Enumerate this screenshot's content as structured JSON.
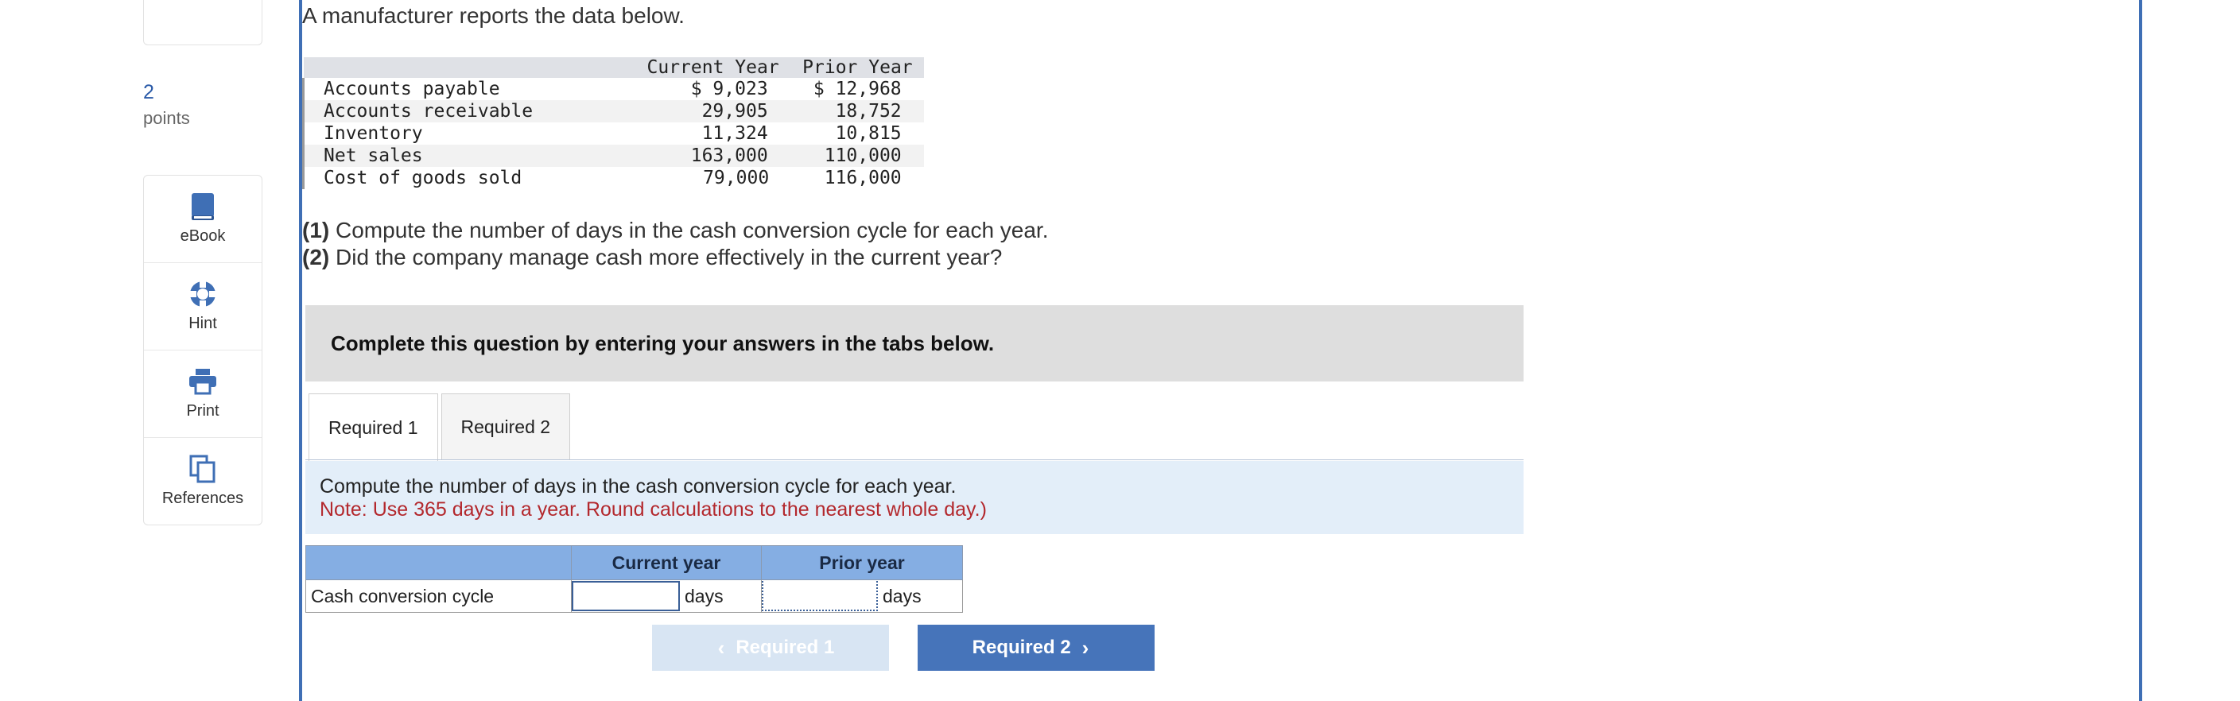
{
  "rail": {
    "stub_number": "",
    "points_value": "2",
    "points_label": "points",
    "tools": [
      {
        "label": "eBook"
      },
      {
        "label": "Hint"
      },
      {
        "label": "Print"
      },
      {
        "label": "References"
      }
    ]
  },
  "question": {
    "intro": "A manufacturer reports the data below.",
    "table": {
      "headers": [
        "Current Year",
        "Prior Year"
      ],
      "rows": [
        {
          "label": "Accounts payable",
          "current": "$ 9,023",
          "prior": "$ 12,968"
        },
        {
          "label": "Accounts receivable",
          "current": "29,905",
          "prior": "18,752"
        },
        {
          "label": "Inventory",
          "current": "11,324",
          "prior": "10,815"
        },
        {
          "label": "Net sales",
          "current": "163,000",
          "prior": "110,000"
        },
        {
          "label": "Cost of goods sold",
          "current": "79,000",
          "prior": "116,000"
        }
      ]
    },
    "parts": [
      {
        "num": "(1)",
        "text": " Compute the number of days in the cash conversion cycle for each year."
      },
      {
        "num": "(2)",
        "text": " Did the company manage cash more effectively in the current year?"
      }
    ]
  },
  "banner": "Complete this question by entering your answers in the tabs below.",
  "tabs": [
    "Required 1",
    "Required 2"
  ],
  "instructions": {
    "text": "Compute the number of days in the cash conversion cycle for each year.",
    "note": "Note: Use 365 days in a year. Round calculations to the nearest whole day.)"
  },
  "answer_table": {
    "headers": [
      "",
      "Current year",
      "Prior year"
    ],
    "row_label": "Cash conversion cycle",
    "current_value": "",
    "prior_value": "",
    "unit": "days"
  },
  "nav": {
    "prev_label": "Required 1",
    "next_label": "Required 2"
  },
  "colors": {
    "accent": "#4674ba",
    "note_red": "#b3282d",
    "instruction_bg": "#e3eef9",
    "header_blue": "#85aee3"
  }
}
